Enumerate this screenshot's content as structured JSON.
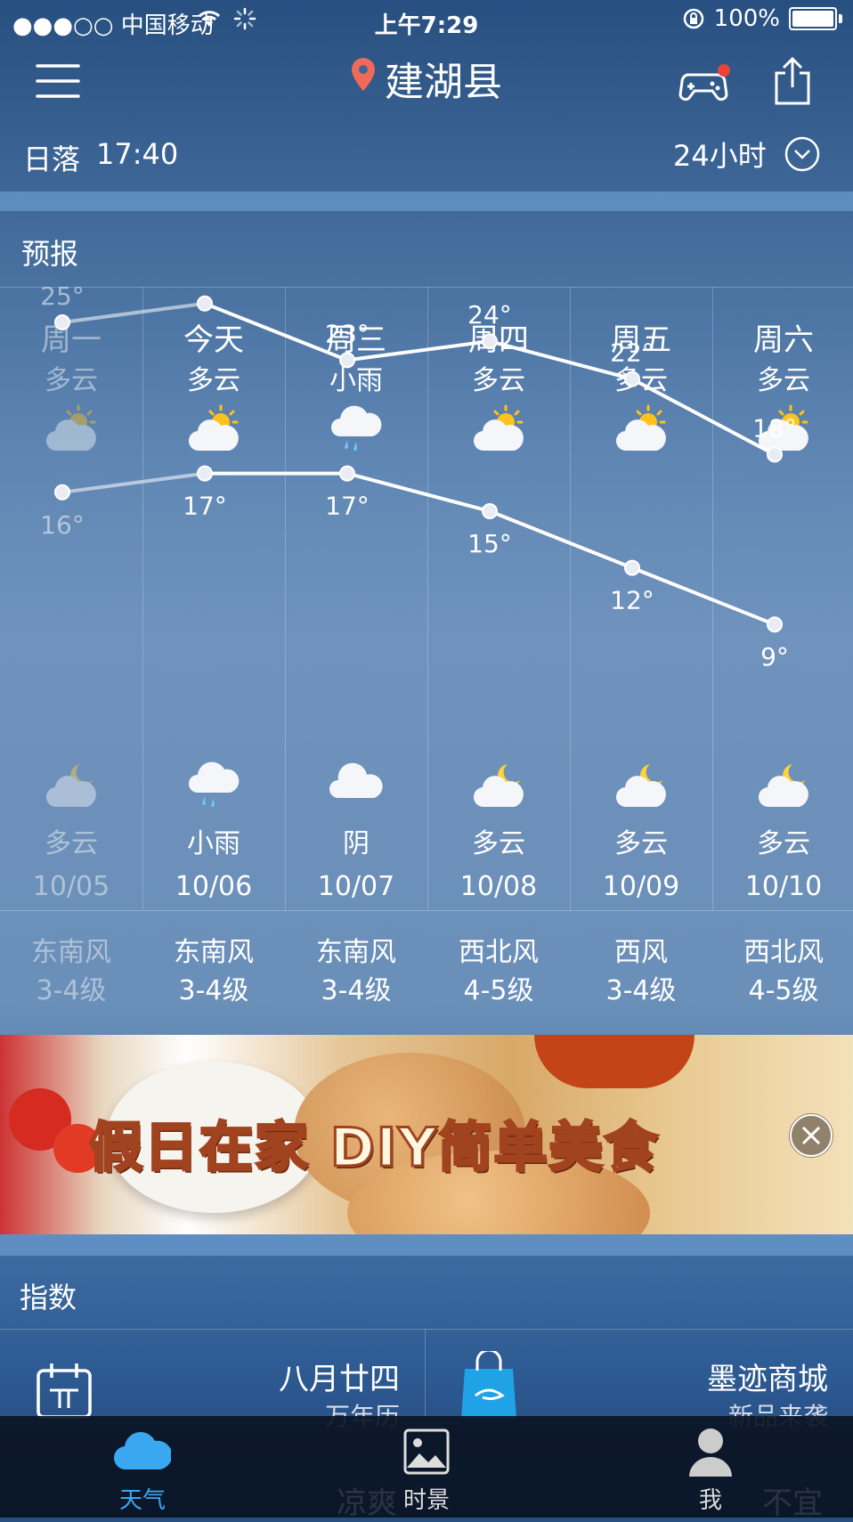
{
  "status_bar": {
    "carrier": "●●●○○ 中国移动",
    "time": "上午7:29",
    "battery": "100%"
  },
  "header": {
    "location": "建湖县",
    "menu_icon": "hamburger-icon",
    "game_icon": "gamepad-icon",
    "share_icon": "share-icon",
    "notification_color": "#e8443a"
  },
  "sun": {
    "label": "日落",
    "time": "17:40",
    "mode_label": "24小时"
  },
  "forecast": {
    "section_title": "预报",
    "days": [
      {
        "day": "周一",
        "cond": "多云",
        "high": "25°",
        "low": "16°",
        "night_cond": "多云",
        "date": "10/05",
        "wind_dir": "东南风",
        "wind_level": "3-4级",
        "day_icon": "partly-cloudy-icon",
        "night_icon": "partly-cloudy-night-icon"
      },
      {
        "day": "今天",
        "cond": "多云",
        "high": "26°",
        "low": "17°",
        "night_cond": "小雨",
        "date": "10/06",
        "wind_dir": "东南风",
        "wind_level": "3-4级",
        "day_icon": "partly-cloudy-icon",
        "night_icon": "light-rain-icon"
      },
      {
        "day": "周三",
        "cond": "小雨",
        "high": "23°",
        "low": "17°",
        "night_cond": "阴",
        "date": "10/07",
        "wind_dir": "东南风",
        "wind_level": "3-4级",
        "day_icon": "light-rain-icon",
        "night_icon": "overcast-icon"
      },
      {
        "day": "周四",
        "cond": "多云",
        "high": "24°",
        "low": "15°",
        "night_cond": "多云",
        "date": "10/08",
        "wind_dir": "西北风",
        "wind_level": "4-5级",
        "day_icon": "partly-cloudy-icon",
        "night_icon": "partly-cloudy-night-icon"
      },
      {
        "day": "周五",
        "cond": "多云",
        "high": "22°",
        "low": "12°",
        "night_cond": "多云",
        "date": "10/09",
        "wind_dir": "西风",
        "wind_level": "3-4级",
        "day_icon": "partly-cloudy-icon",
        "night_icon": "partly-cloudy-night-icon"
      },
      {
        "day": "周六",
        "cond": "多云",
        "high": "18°",
        "low": "9°",
        "night_cond": "多云",
        "date": "10/10",
        "wind_dir": "西北风",
        "wind_level": "4-5级",
        "day_icon": "partly-cloudy-icon",
        "night_icon": "partly-cloudy-night-icon"
      }
    ]
  },
  "chart_data": {
    "type": "line",
    "categories": [
      "10/05",
      "10/06",
      "10/07",
      "10/08",
      "10/09",
      "10/10"
    ],
    "series": [
      {
        "values": [
          25,
          26,
          23,
          24,
          22,
          18
        ]
      },
      {
        "values": [
          16,
          17,
          17,
          15,
          12,
          9
        ]
      }
    ]
  },
  "banner": {
    "text": "假日在家 DIY简单美食",
    "close_icon": "close-icon"
  },
  "index": {
    "section_title": "指数",
    "tiles": [
      {
        "title": "八月廿四",
        "subtitle": "万年历",
        "icon": "calendar-icon"
      },
      {
        "title": "墨迹商城",
        "subtitle": "新品来袭",
        "icon": "shopping-bag-icon"
      }
    ]
  },
  "tabbar": {
    "tabs": [
      {
        "label": "天气",
        "icon": "cloud-icon",
        "active": true
      },
      {
        "label": "时景",
        "icon": "picture-icon",
        "active": false
      },
      {
        "label": "我",
        "icon": "person-icon",
        "active": false
      }
    ],
    "ghost_left": "凉爽",
    "ghost_right": "不宜",
    "active_color": "#3aa8f0"
  }
}
